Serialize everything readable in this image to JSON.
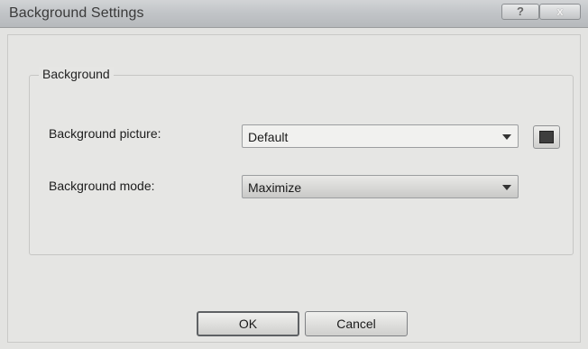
{
  "window": {
    "title": "Background Settings",
    "help_glyph": "?",
    "close_glyph": "x"
  },
  "group": {
    "label": "Background"
  },
  "fields": {
    "picture_label": "Background picture:",
    "picture_value": "Default",
    "mode_label": "Background mode:",
    "mode_value": "Maximize",
    "swatch_color": "#3e3e3e"
  },
  "buttons": {
    "ok_label": "OK",
    "cancel_label": "Cancel"
  }
}
